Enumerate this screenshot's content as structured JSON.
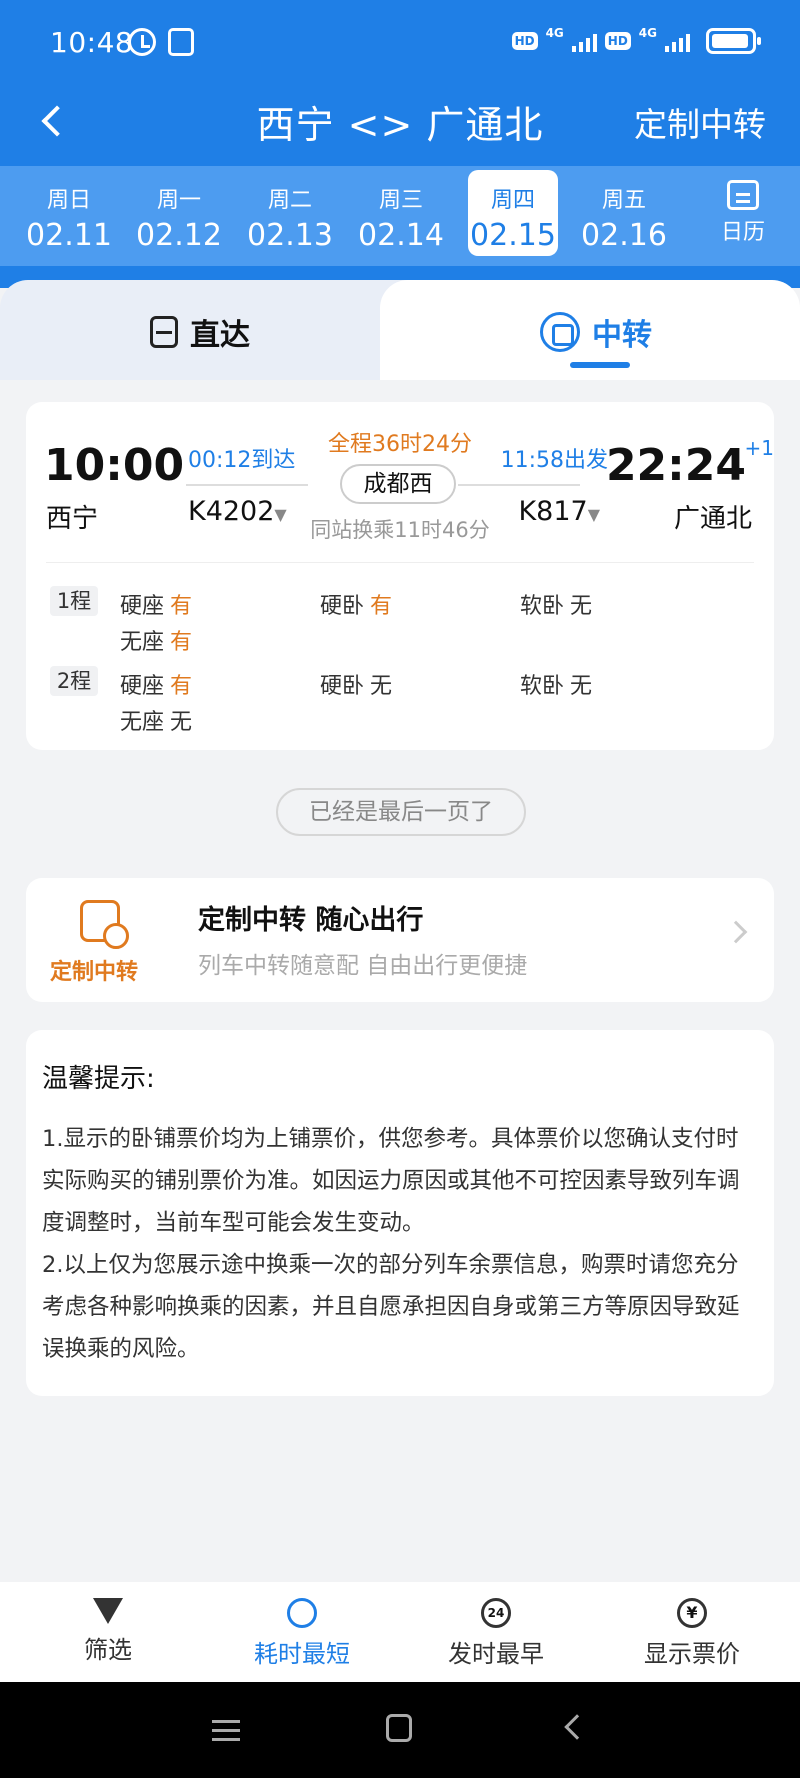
{
  "status": {
    "time": "10:48",
    "hd": "HD",
    "net": "4G"
  },
  "nav": {
    "title": "西宁 <> 广通北",
    "right": "定制中转"
  },
  "dates": [
    {
      "weekday": "周日",
      "date": "02.11"
    },
    {
      "weekday": "周一",
      "date": "02.12"
    },
    {
      "weekday": "周二",
      "date": "02.13"
    },
    {
      "weekday": "周三",
      "date": "02.14"
    },
    {
      "weekday": "周四",
      "date": "02.15",
      "selected": true
    },
    {
      "weekday": "周五",
      "date": "02.16"
    }
  ],
  "calendar_label": "日历",
  "tabs": {
    "direct": "直达",
    "transfer": "中转"
  },
  "trip": {
    "dep_time": "10:00",
    "dep_station": "西宁",
    "arr_time": "22:24",
    "arr_plus": "+1",
    "arr_station": "广通北",
    "arrive_note": "00:12到达",
    "depart_note": "11:58出发",
    "total": "全程36时24分",
    "transfer_station": "成都西",
    "train1": "K4202",
    "train2": "K817",
    "wait": "同站换乘11时46分",
    "segments": [
      {
        "tag": "1程",
        "seats": [
          {
            "name": "硬座",
            "value": "有"
          },
          {
            "name": "硬卧",
            "value": "有"
          },
          {
            "name": "软卧",
            "value": "无"
          },
          {
            "name": "无座",
            "value": "有"
          }
        ]
      },
      {
        "tag": "2程",
        "seats": [
          {
            "name": "硬座",
            "value": "有"
          },
          {
            "name": "硬卧",
            "value": "无"
          },
          {
            "name": "软卧",
            "value": "无"
          },
          {
            "name": "无座",
            "value": "无"
          }
        ]
      }
    ]
  },
  "last_page": "已经是最后一页了",
  "promo": {
    "brand": "定制中转",
    "title": "定制中转 随心出行",
    "subtitle": "列车中转随意配 自由出行更便捷"
  },
  "tips": {
    "title": "温馨提示:",
    "lines": [
      "1.显示的卧铺票价均为上铺票价，供您参考。具体票价以您确认支付时实际购买的铺别票价为准。如因运力原因或其他不可控因素导致列车调度调整时，当前车型可能会发生变动。",
      "2.以上仅为您展示途中换乘一次的部分列车余票信息，购票时请您充分考虑各种影响换乘的因素，并且自愿承担因自身或第三方等原因导致延误换乘的风险。"
    ]
  },
  "bottom": {
    "filter": "筛选",
    "shortest": "耗时最短",
    "earliest": "发时最早",
    "price": "显示票价",
    "earliest_icon_text": "24",
    "price_icon_text": "¥"
  },
  "colors": {
    "primary": "#1f7fe6",
    "accent": "#e07a1f"
  }
}
